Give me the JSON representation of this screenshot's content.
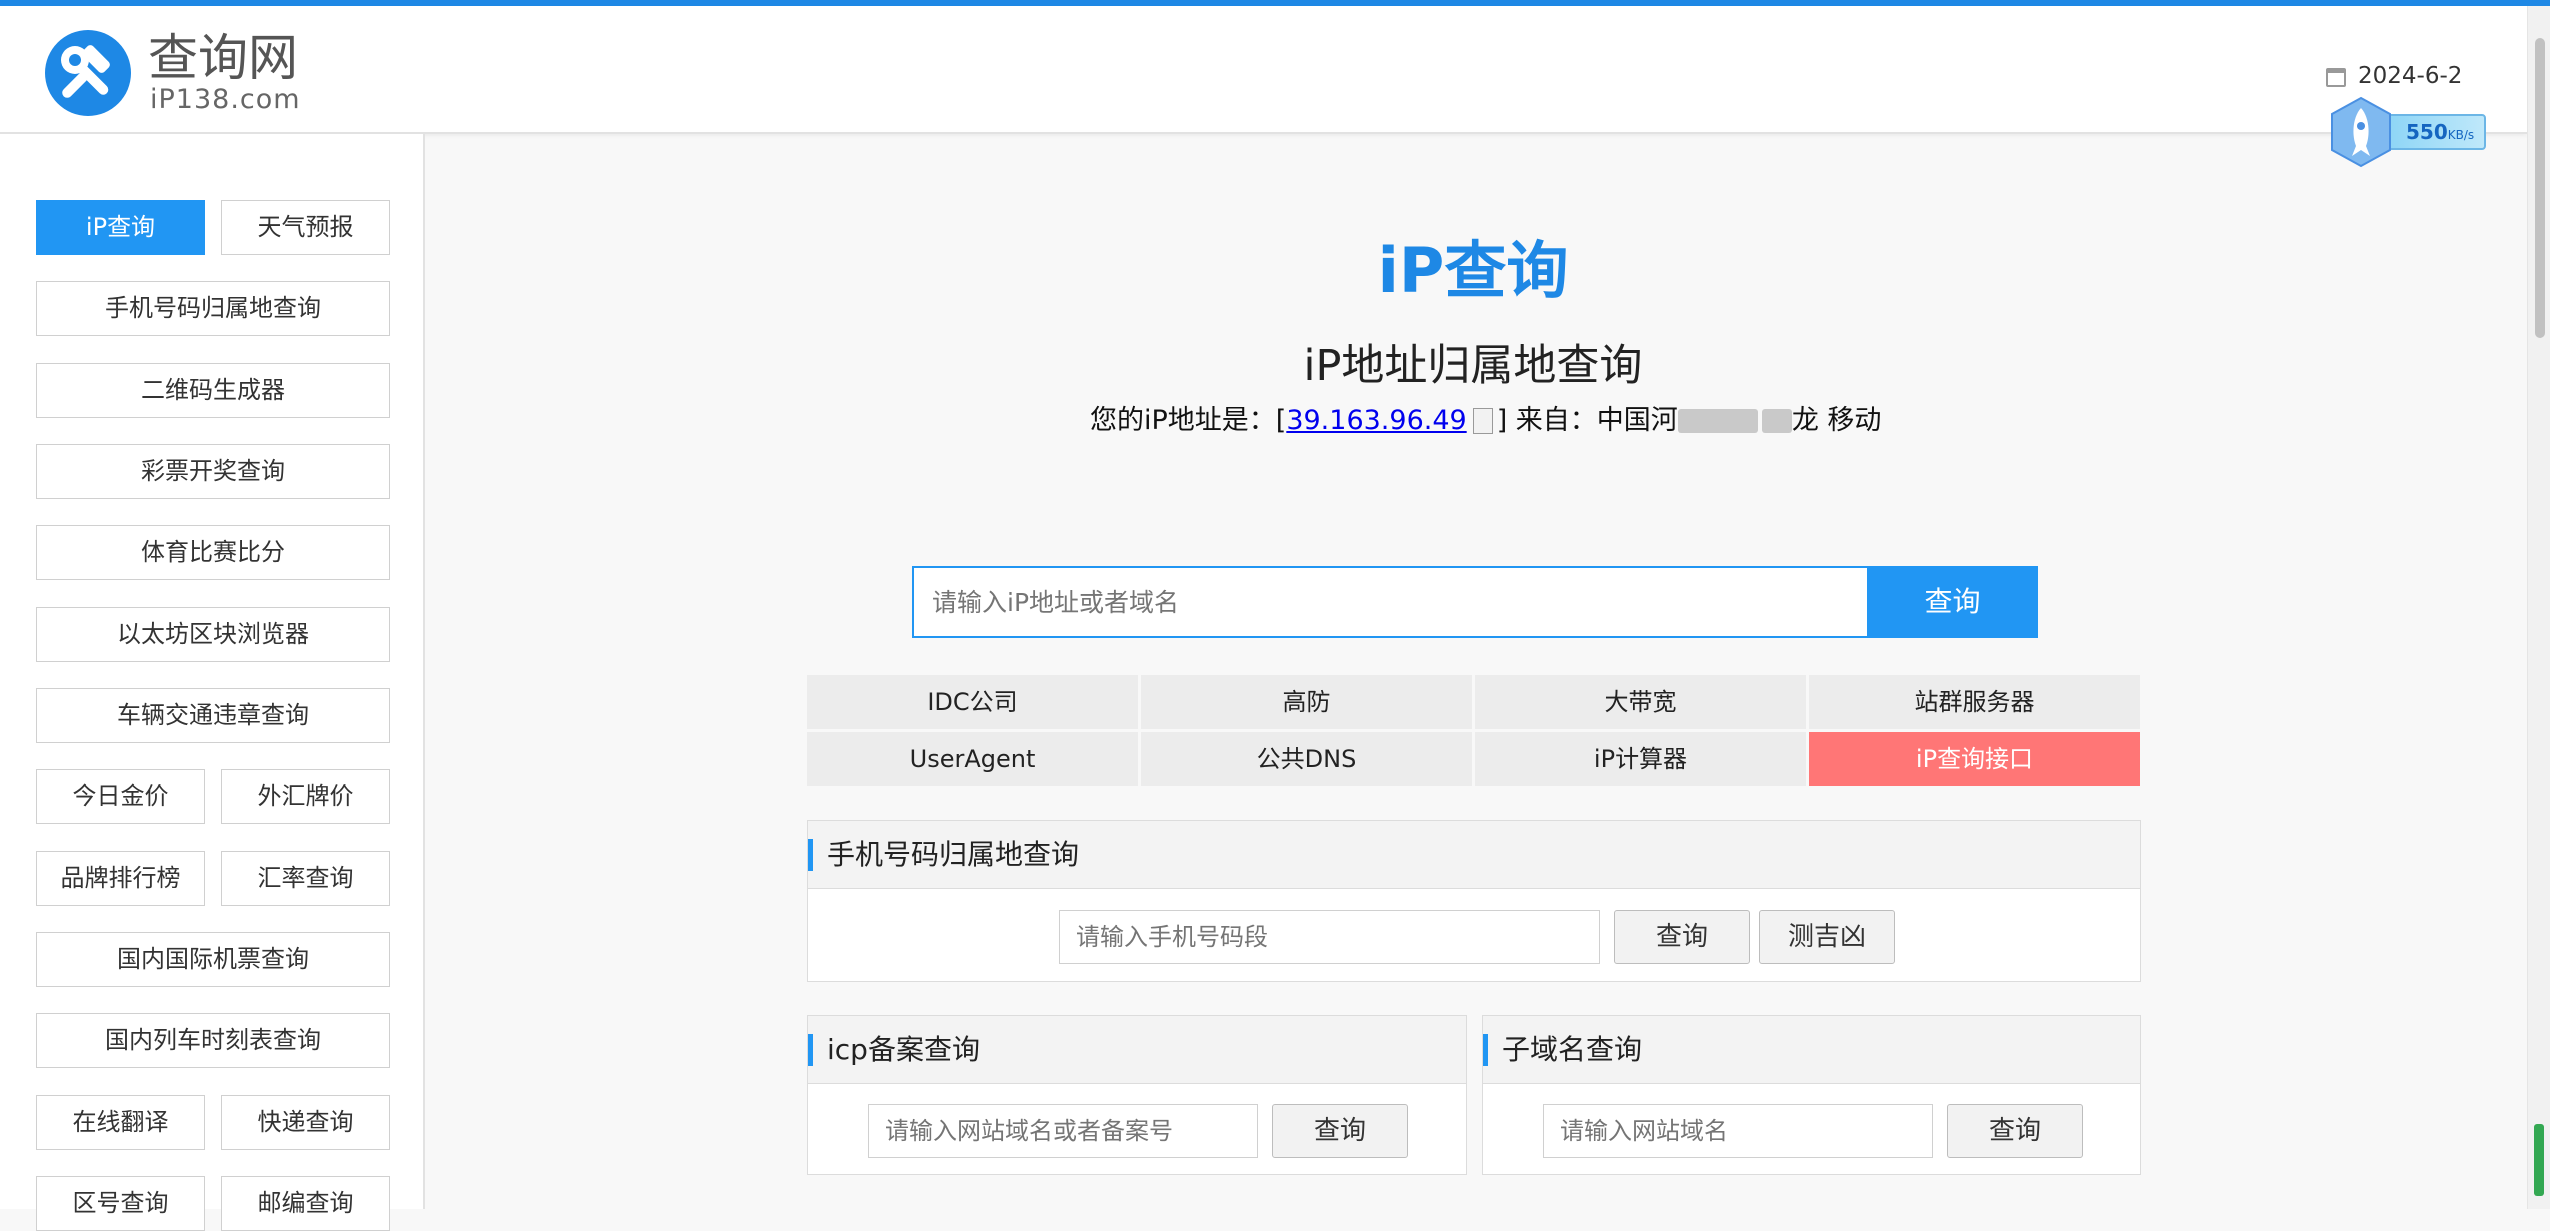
{
  "header": {
    "logo_title": "查询网",
    "logo_domain": "iP138.com",
    "date": "2024-6-2",
    "speed_value": "550",
    "speed_unit": "KB/s"
  },
  "sidebar": {
    "items": [
      {
        "label": "iP查询",
        "active": true
      },
      {
        "label": "天气预报"
      },
      {
        "label": "手机号码归属地查询"
      },
      {
        "label": "二维码生成器"
      },
      {
        "label": "彩票开奖查询"
      },
      {
        "label": "体育比赛比分"
      },
      {
        "label": "以太坊区块浏览器"
      },
      {
        "label": "车辆交通违章查询"
      },
      {
        "label": "今日金价"
      },
      {
        "label": "外汇牌价"
      },
      {
        "label": "品牌排行榜"
      },
      {
        "label": "汇率查询"
      },
      {
        "label": "国内国际机票查询"
      },
      {
        "label": "国内列车时刻表查询"
      },
      {
        "label": "在线翻译"
      },
      {
        "label": "快递查询"
      },
      {
        "label": "区号查询"
      },
      {
        "label": "邮编查询"
      }
    ]
  },
  "main": {
    "title": "iP查询",
    "subtitle": "iP地址归属地查询",
    "ip_prefix": "您的iP地址是：[",
    "ip_address": "39.163.96.49",
    "ip_from_pre": "] 来自：中国河",
    "ip_from_mid": "龙",
    "ip_from_post": " 移动",
    "search": {
      "placeholder": "请输入iP地址或者域名",
      "button": "查询"
    },
    "quick_links": [
      "IDC公司",
      "高防",
      "大带宽",
      "站群服务器",
      "UserAgent",
      "公共DNS",
      "iP计算器",
      "iP查询接口"
    ]
  },
  "phone_panel": {
    "title": "手机号码归属地查询",
    "placeholder": "请输入手机号码段",
    "query_button": "查询",
    "fortune_button": "测吉凶"
  },
  "icp_panel": {
    "title": "icp备案查询",
    "placeholder": "请输入网站域名或者备案号",
    "query_button": "查询"
  },
  "subdomain_panel": {
    "title": "子域名查询",
    "placeholder": "请输入网站域名",
    "query_button": "查询"
  },
  "colors": {
    "accent": "#2196f3",
    "hot": "#ff7676",
    "header_line": "#1e88e5"
  }
}
